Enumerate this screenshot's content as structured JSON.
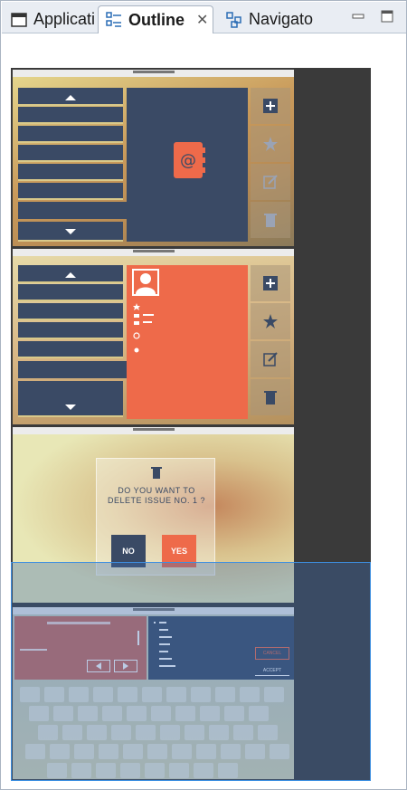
{
  "tabs": [
    {
      "label": "Applicati",
      "icon": "window-icon",
      "active": false
    },
    {
      "label": "Outline",
      "icon": "outline-icon",
      "active": true
    },
    {
      "label": "Navigato",
      "icon": "navigator-icon",
      "active": false
    }
  ],
  "window_controls": {
    "minimize": "minimize-icon",
    "maximize": "maximize-icon"
  },
  "screens": {
    "screen3": {
      "question": "DO YOU WANT TO DELETE ISSUE NO. 1 ?",
      "no_label": "NO",
      "yes_label": "YES"
    },
    "screen4": {
      "cancel_label": "CANCEL",
      "accept_label": "ACCEPT"
    }
  },
  "colors": {
    "navy": "#3a4a65",
    "salmon": "#ee6a4a",
    "selection": "#3d8fe0",
    "canvas": "#3a3a3a"
  }
}
